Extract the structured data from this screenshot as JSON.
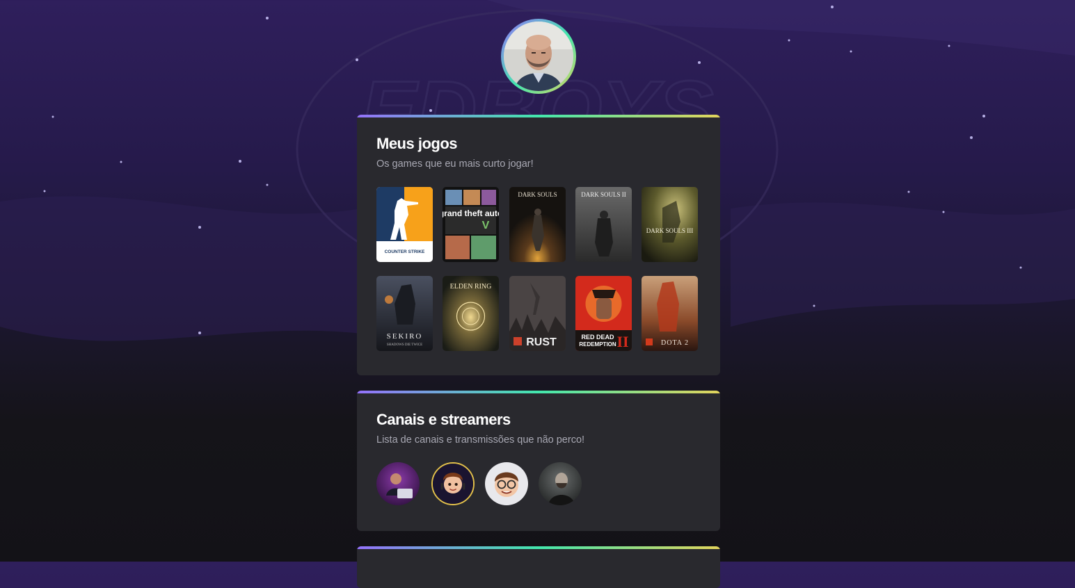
{
  "profile": {
    "avatar_icon": "profile-photo"
  },
  "games_card": {
    "title": "Meus jogos",
    "subtitle": "Os games que eu mais curto jogar!",
    "games": [
      {
        "name": "Counter-Strike",
        "cover_text": "COUNTER STRIKE"
      },
      {
        "name": "Grand Theft Auto V",
        "cover_text": "grand theft auto"
      },
      {
        "name": "Dark Souls",
        "cover_text": "DARK SOULS"
      },
      {
        "name": "Dark Souls II",
        "cover_text": "DARK SOULS II"
      },
      {
        "name": "Dark Souls III",
        "cover_text": "DARK SOULS III"
      },
      {
        "name": "Sekiro",
        "cover_text": "SEKIRO",
        "cover_subtext": "SHADOWS DIE TWICE"
      },
      {
        "name": "Elden Ring",
        "cover_text": "ELDEN RING"
      },
      {
        "name": "Rust",
        "cover_text": "RUST"
      },
      {
        "name": "Red Dead Redemption II",
        "cover_text": "RED DEAD",
        "cover_subtext": "REDEMPTION"
      },
      {
        "name": "Dota 2",
        "cover_text": "DOTA 2"
      }
    ]
  },
  "streamers_card": {
    "title": "Canais e streamers",
    "subtitle": "Lista de canais e transmissões que não perco!",
    "streamers": [
      {
        "icon": "streamer-avatar-1"
      },
      {
        "icon": "streamer-avatar-2"
      },
      {
        "icon": "streamer-avatar-3"
      },
      {
        "icon": "streamer-avatar-4"
      }
    ]
  },
  "colors": {
    "accent_gradient": [
      "#9572fc",
      "#43e7ad",
      "#e2d45c"
    ],
    "card_bg": "#29292e",
    "text_muted": "#a8a8b3"
  }
}
